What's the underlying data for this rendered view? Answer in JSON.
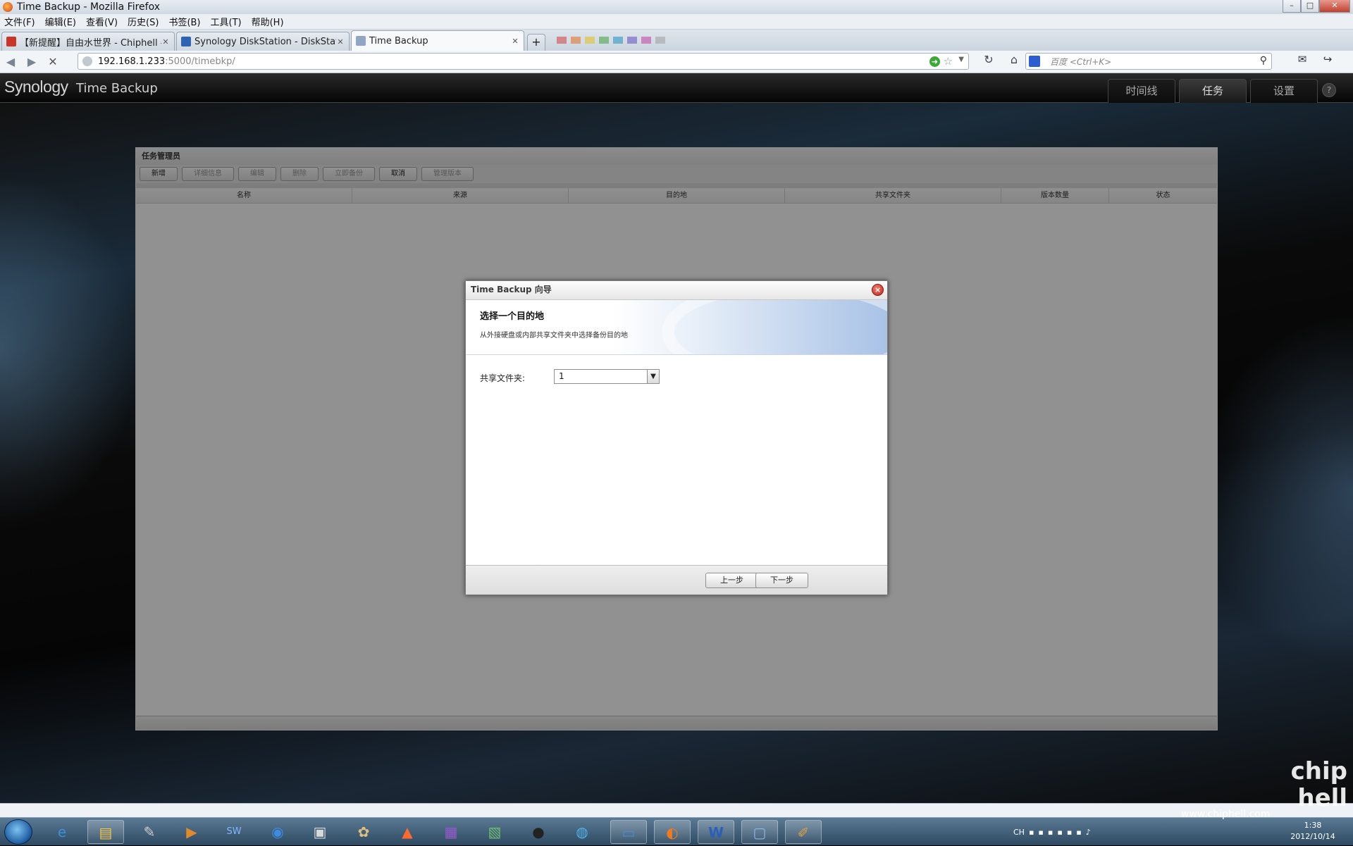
{
  "window": {
    "title": "Time Backup - Mozilla Firefox"
  },
  "menu": [
    "文件(F)",
    "编辑(E)",
    "查看(V)",
    "历史(S)",
    "书签(B)",
    "工具(T)",
    "帮助(H)"
  ],
  "tabs": [
    {
      "label": "【新提醒】自由水世界 - Chiphell - ...",
      "icon": "chiphell-icon",
      "color": "#c8352b"
    },
    {
      "label": "Synology DiskStation - DiskStation",
      "icon": "dsm-icon",
      "color": "#2f63b3"
    },
    {
      "label": "Time Backup",
      "icon": "page-icon",
      "color": "#8fa7c4"
    }
  ],
  "tab_new_label": "+",
  "tab_swatches": [
    "#d04040",
    "#e07020",
    "#e0c020",
    "#40a040",
    "#2090c0",
    "#6050c0",
    "#c040a0",
    "#a0a0a0"
  ],
  "url": {
    "host": "192.168.1.233",
    "path": ":5000/timebkp/"
  },
  "search": {
    "placeholder": "百度 <Ctrl+K>"
  },
  "app": {
    "logo": "Synology",
    "name": "Time Backup",
    "tabs": [
      "时间线",
      "任务",
      "设置"
    ],
    "help": "?"
  },
  "task_manager": {
    "title": "任务管理员",
    "buttons": [
      {
        "label": "新增",
        "enabled": true
      },
      {
        "label": "详细信息",
        "enabled": false
      },
      {
        "label": "编辑",
        "enabled": false
      },
      {
        "label": "删除",
        "enabled": false
      },
      {
        "label": "立即备份",
        "enabled": false
      },
      {
        "label": "取消",
        "enabled": true
      },
      {
        "label": "管理版本",
        "enabled": false
      }
    ],
    "columns": [
      "名称",
      "来源",
      "目的地",
      "共享文件夹",
      "版本数量",
      "状态"
    ]
  },
  "wizard": {
    "title": "Time Backup 向导",
    "close": "×",
    "heading": "选择一个目的地",
    "subheading": "从外接硬盘或内部共享文件夹中选择备份目的地",
    "field_label": "共享文件夹:",
    "field_value": "1",
    "back_button": "上一步",
    "next_button": "下一步"
  },
  "tray": {
    "lang": "CH",
    "time": "1:38",
    "date": "2012/10/14"
  },
  "watermark": "www.chiphell.com",
  "chiphell_logo": "chip hell"
}
